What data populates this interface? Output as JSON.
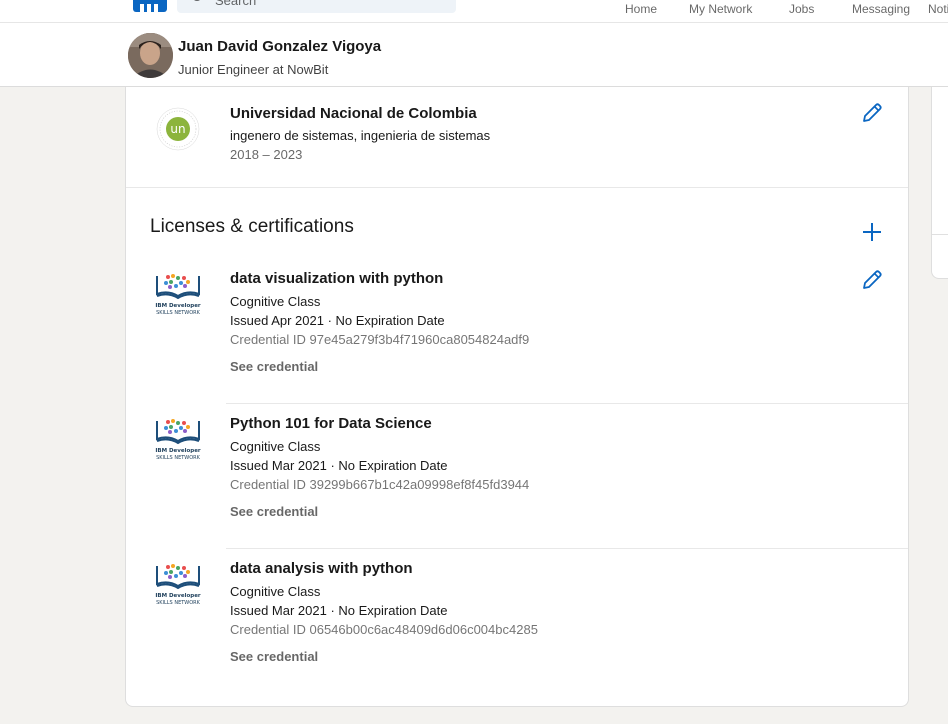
{
  "nav": {
    "search_placeholder": "Search",
    "items": [
      "Home",
      "My Network",
      "Jobs",
      "Messaging",
      "Notifications"
    ]
  },
  "profile": {
    "name": "Juan David Gonzalez Vigoya",
    "headline": "Junior Engineer at NowBit"
  },
  "education": {
    "school": "Universidad Nacional de Colombia",
    "degree": "ingenero de sistemas, ingenieria de sistemas",
    "dates": "2018 – 2023",
    "logo_text": "un",
    "logo_ring_text": "UNIVERSIDAD NACIONAL DE COLOMBIA"
  },
  "certifications": {
    "title": "Licenses & certifications",
    "items": [
      {
        "name": "data visualization with python",
        "issuer": "Cognitive Class",
        "issued": "Issued Apr 2021 · No Expiration Date",
        "credential": "Credential ID 97e45a279f3b4f71960ca8054824adf9",
        "see": "See credential"
      },
      {
        "name": "Python 101 for Data Science",
        "issuer": "Cognitive Class",
        "issued": "Issued Mar 2021 · No Expiration Date",
        "credential": "Credential ID 39299b667b1c42a09998ef8f45fd3944",
        "see": "See credential"
      },
      {
        "name": "data analysis with python",
        "issuer": "Cognitive Class",
        "issued": "Issued Mar 2021 · No Expiration Date",
        "credential": "Credential ID 06546b00c6ac48409d6d06c004bc4285",
        "see": "See credential"
      }
    ],
    "logo_text": [
      "IBM Developer",
      "SKILLS NETWORK"
    ]
  },
  "colors": {
    "brand": "#0a66c2",
    "un_green": "#8cb43c"
  }
}
